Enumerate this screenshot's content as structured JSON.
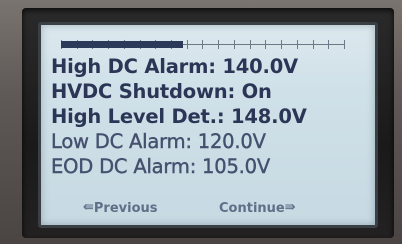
{
  "screen": {
    "lines": [
      "High DC Alarm: 140.0V",
      "HVDC Shutdown: On",
      "High Level Det.: 148.0V",
      "Low DC Alarm: 120.0V",
      "EOD DC Alarm: 105.0V"
    ],
    "nav": {
      "previous_label": "Previous",
      "continue_label": "Continue",
      "previous_icon": "left-arrow-icon",
      "continue_icon": "right-arrow-icon"
    },
    "scroll": {
      "position_fraction": 0.43,
      "tick_count": 19
    }
  },
  "colors": {
    "lcd_background": "#cfe0e8",
    "text": "#2b3556",
    "nav_text": "#5f6f88"
  }
}
